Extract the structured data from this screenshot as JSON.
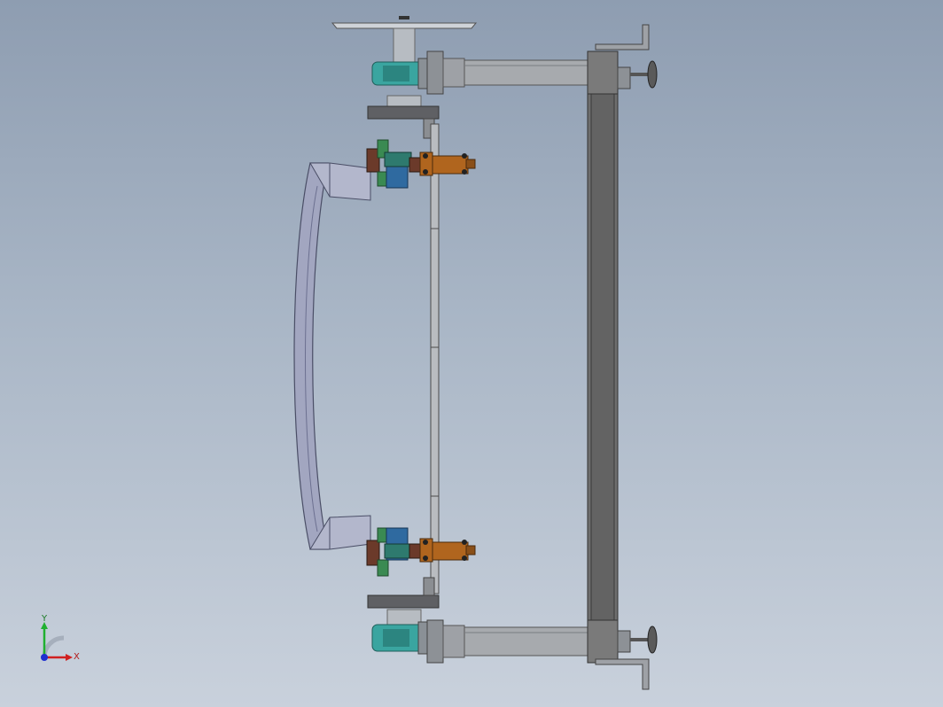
{
  "viewport": {
    "background_top": "#8e9db1",
    "background_bottom": "#c9d1dc"
  },
  "model": {
    "frame_color": "#6e6e6e",
    "steel_color": "#9ea1a6",
    "hub_color": "#3aa5a0",
    "cylinder_color": "#b0651e",
    "clamp_color": "#6b3a2a",
    "bracket_color": "#3a8a52",
    "block_color": "#2f6aa0",
    "arc_color": "#a2a6c0"
  },
  "triad": {
    "x_label": "X",
    "y_label": "Y",
    "x_color": "#d02020",
    "y_color": "#20b030",
    "z_color": "#2030d0"
  }
}
